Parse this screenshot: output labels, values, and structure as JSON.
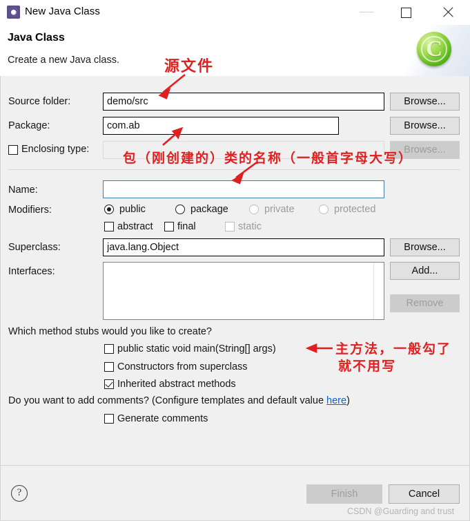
{
  "window": {
    "title": "New Java Class",
    "icon": "java-class-icon",
    "controls": {
      "minimize": "—",
      "maximize": "□",
      "close": "✕"
    }
  },
  "header": {
    "title": "Java Class",
    "subtitle": "Create a new Java class.",
    "badge_letter": "C",
    "badge_name": "java-green-c-badge"
  },
  "form": {
    "source_folder": {
      "label": "Source folder:",
      "value": "demo/src",
      "browse": "Browse..."
    },
    "package": {
      "label": "Package:",
      "value": "com.ab",
      "browse": "Browse..."
    },
    "enclosing_type": {
      "label": "Enclosing type:",
      "value": "",
      "browse": "Browse...",
      "checked": false,
      "disabled": true
    },
    "name": {
      "label": "Name:",
      "value": "",
      "placeholder": ""
    },
    "modifiers": {
      "label": "Modifiers:",
      "radios": [
        {
          "label": "public",
          "selected": true,
          "disabled": false
        },
        {
          "label": "package",
          "selected": false,
          "disabled": false
        },
        {
          "label": "private",
          "selected": false,
          "disabled": true
        },
        {
          "label": "protected",
          "selected": false,
          "disabled": true
        }
      ],
      "checks": [
        {
          "label": "abstract",
          "checked": false,
          "disabled": false
        },
        {
          "label": "final",
          "checked": false,
          "disabled": false
        },
        {
          "label": "static",
          "checked": false,
          "disabled": true
        }
      ]
    },
    "superclass": {
      "label": "Superclass:",
      "value": "java.lang.Object",
      "browse": "Browse..."
    },
    "interfaces": {
      "label": "Interfaces:",
      "items": [],
      "add": "Add...",
      "remove": "Remove"
    }
  },
  "stubs": {
    "question": "Which method stubs would you like to create?",
    "options": [
      {
        "label": "public static void main(String[] args)",
        "checked": false
      },
      {
        "label": "Constructors from superclass",
        "checked": false
      },
      {
        "label": "Inherited abstract methods",
        "checked": true
      }
    ]
  },
  "comments": {
    "question_prefix": "Do you want to add comments? (Configure templates and default value ",
    "link": "here",
    "question_suffix": ")",
    "option": {
      "label": "Generate comments",
      "checked": false
    }
  },
  "footer": {
    "help": "?",
    "finish": "Finish",
    "finish_disabled": true,
    "cancel": "Cancel",
    "watermark": "CSDN @Guarding and trust"
  },
  "annotations": {
    "color": "#e02020",
    "items": [
      {
        "name": "annotation-source-file",
        "text": "源文件"
      },
      {
        "name": "annotation-package",
        "text": "包（刚创建的）"
      },
      {
        "name": "annotation-class-name",
        "text": "类的名称（一般首字母大写）"
      },
      {
        "name": "annotation-main-method-1",
        "text": "主方法，一般勾了"
      },
      {
        "name": "annotation-main-method-2",
        "text": "就不用写"
      }
    ]
  }
}
